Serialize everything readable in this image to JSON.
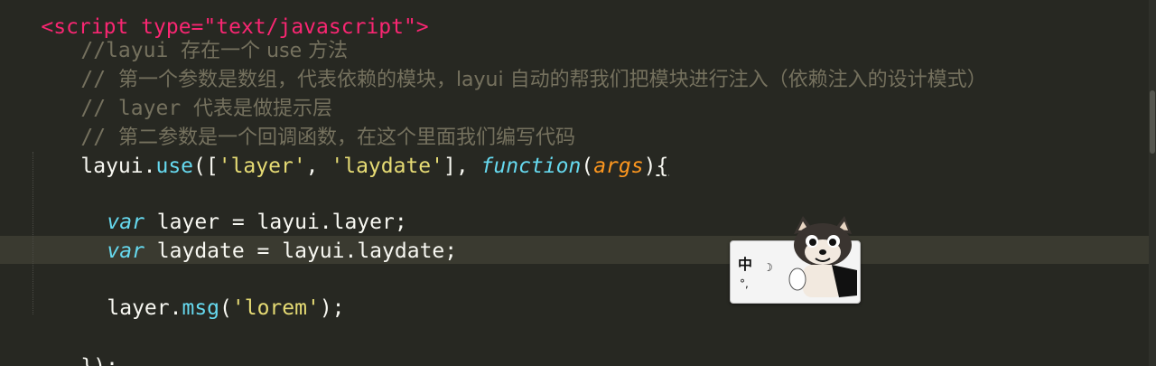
{
  "editor": {
    "lines": {
      "l0": {
        "partial_tag": "<script type=\"text/javascript\">"
      },
      "l1": {
        "comment_prefix": "//layui ",
        "comment_text": "存在一个 use 方法"
      },
      "l2": {
        "comment_prefix": "// ",
        "comment_text": "第一个参数是数组，代表依赖的模块，layui 自动的帮我们把模块进行注入（依赖注入的设计模式）"
      },
      "l3": {
        "comment_prefix": "// layer ",
        "comment_text": "代表是做提示层"
      },
      "l4": {
        "comment_prefix": "// ",
        "comment_text": "第二参数是一个回调函数，在这个里面我们编写代码"
      },
      "l5": {
        "obj": "layui.",
        "method": "use",
        "open": "([",
        "str1": "'layer'",
        "comma": ", ",
        "str2": "'laydate'",
        "close": "], ",
        "kw": "function",
        "paren_open": "(",
        "arg": "args",
        "paren_close": ")",
        "brace": "{"
      },
      "l7": {
        "kw": "var",
        "rest": " layer = layui.layer;"
      },
      "l8": {
        "kw": "var",
        "rest": " laydate = layui.laydate;"
      },
      "l10": {
        "obj": "layer.",
        "method": "msg",
        "open": "(",
        "str": "'lorem'",
        "close": ");"
      },
      "l12": {
        "brace": "}",
        "rest": ");"
      }
    }
  },
  "ime": {
    "mode_char": "中",
    "moon_dot": "☽",
    "punct": "°,",
    "mascot": "shiba-dog-mascot"
  },
  "colors": {
    "background": "#272822",
    "comment": "#75715e",
    "string": "#e6db74",
    "function": "#66d9ef",
    "argument": "#fd971f",
    "tag": "#f92672",
    "text": "#f8f8f2"
  }
}
